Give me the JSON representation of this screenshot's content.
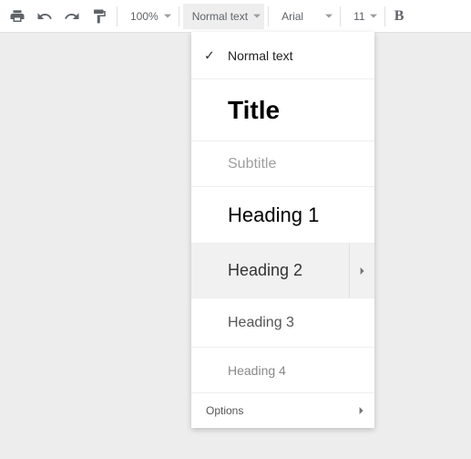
{
  "toolbar": {
    "zoom": "100%",
    "style_selected": "Normal text",
    "font": "Arial",
    "font_size": "11",
    "bold_label": "B"
  },
  "style_menu": {
    "items": [
      {
        "label": "Normal text",
        "checked": true
      },
      {
        "label": "Title"
      },
      {
        "label": "Subtitle"
      },
      {
        "label": "Heading 1"
      },
      {
        "label": "Heading 2",
        "hovered": true
      },
      {
        "label": "Heading 3"
      },
      {
        "label": "Heading 4"
      }
    ],
    "options_label": "Options"
  }
}
